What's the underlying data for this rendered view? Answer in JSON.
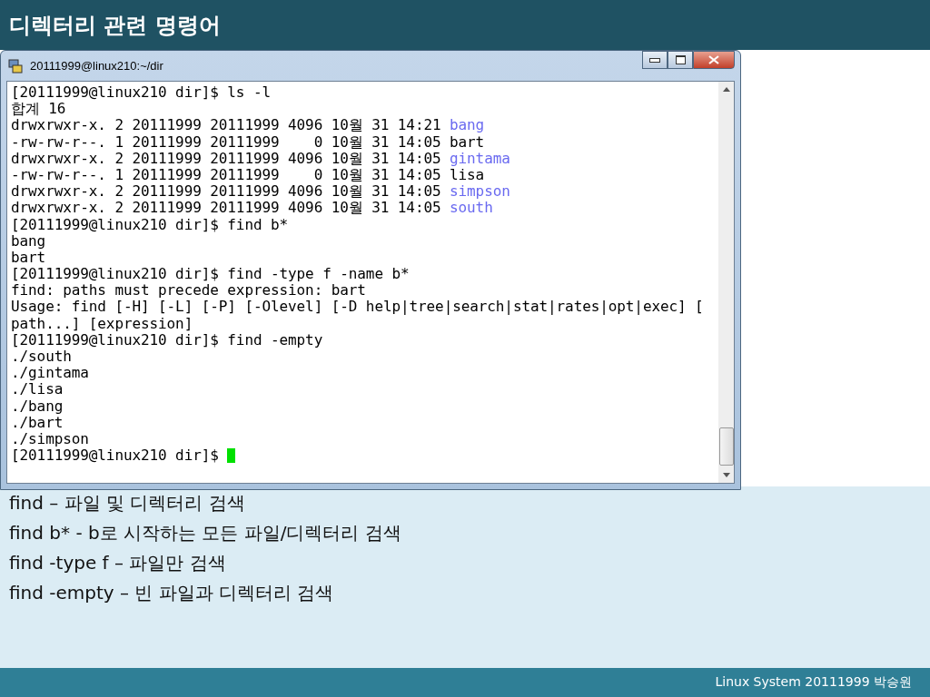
{
  "slide_title": "디렉터리 관련 명령어",
  "window": {
    "title": "20111999@linux210:~/dir"
  },
  "terminal_lines": [
    {
      "text": "[20111999@linux210 dir]$ ls -l"
    },
    {
      "text": "합계 16"
    },
    {
      "text": "drwxrwxr-x. 2 20111999 20111999 4096 10월 31 14:21 ",
      "name": "bang",
      "kind": "dir"
    },
    {
      "text": "-rw-rw-r--. 1 20111999 20111999    0 10월 31 14:05 ",
      "name": "bart",
      "kind": "file"
    },
    {
      "text": "drwxrwxr-x. 2 20111999 20111999 4096 10월 31 14:05 ",
      "name": "gintama",
      "kind": "dir"
    },
    {
      "text": "-rw-rw-r--. 1 20111999 20111999    0 10월 31 14:05 ",
      "name": "lisa",
      "kind": "file"
    },
    {
      "text": "drwxrwxr-x. 2 20111999 20111999 4096 10월 31 14:05 ",
      "name": "simpson",
      "kind": "dir"
    },
    {
      "text": "drwxrwxr-x. 2 20111999 20111999 4096 10월 31 14:05 ",
      "name": "south",
      "kind": "dir"
    },
    {
      "text": "[20111999@linux210 dir]$ find b*"
    },
    {
      "text": "bang"
    },
    {
      "text": "bart"
    },
    {
      "text": "[20111999@linux210 dir]$ find -type f -name b*"
    },
    {
      "text": "find: paths must precede expression: bart"
    },
    {
      "text": "Usage: find [-H] [-L] [-P] [-Olevel] [-D help|tree|search|stat|rates|opt|exec] ["
    },
    {
      "text": "path...] [expression]"
    },
    {
      "text": "[20111999@linux210 dir]$ find -empty"
    },
    {
      "text": "./south"
    },
    {
      "text": "./gintama"
    },
    {
      "text": "./lisa"
    },
    {
      "text": "./bang"
    },
    {
      "text": "./bart"
    },
    {
      "text": "./simpson"
    },
    {
      "text": "[20111999@linux210 dir]$ ",
      "cursor": true
    }
  ],
  "notes": [
    "find – 파일 및 디렉터리 검색",
    "find b* - b로 시작하는 모든 파일/디렉터리 검색",
    "find -type f – 파일만 검색",
    "find -empty – 빈 파일과 디렉터리 검색"
  ],
  "footer": "Linux System 20111999 박승원"
}
